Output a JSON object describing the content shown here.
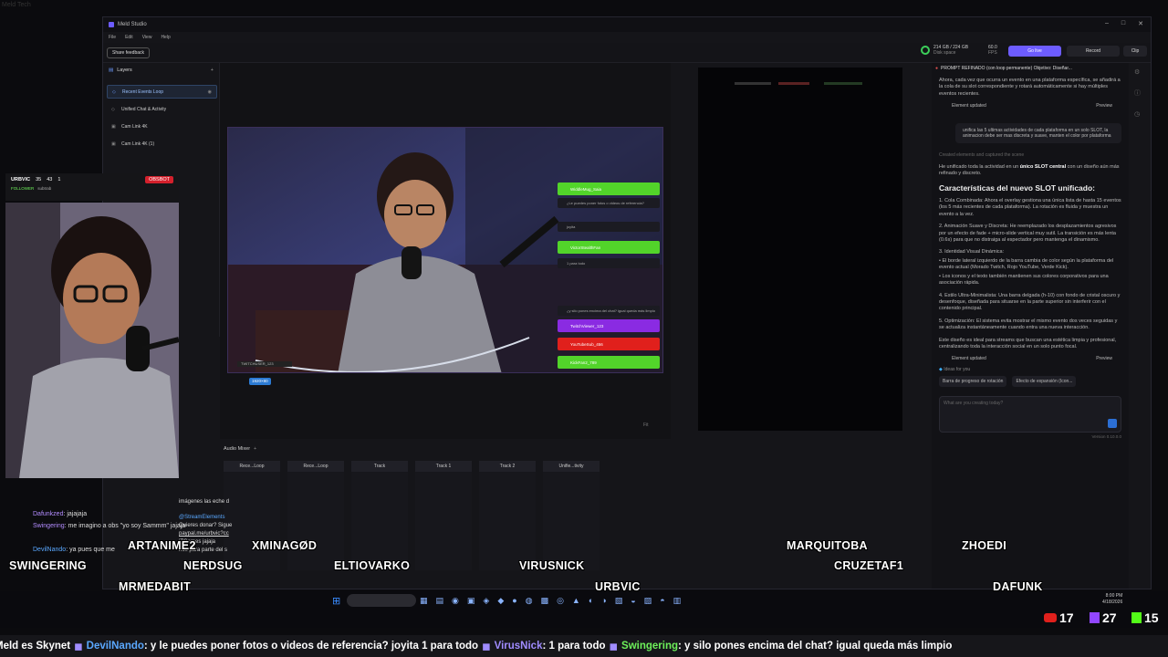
{
  "corner_text": "Meld Tech",
  "app": {
    "title": "Meld Studio",
    "menu": [
      "File",
      "Edit",
      "View",
      "Help"
    ],
    "share_feedback": "Share feedback",
    "disk": {
      "value": "214 GB / 224 GB",
      "label": "Disk space"
    },
    "fps": {
      "value": "60.0",
      "label": "FPS"
    },
    "go_live": "Go live",
    "record": "Record",
    "clip": "Clip"
  },
  "layers": {
    "title": "Layers",
    "items": [
      {
        "label": "Recent Events Loop",
        "selected": true
      },
      {
        "label": "Unified Chat & Activity",
        "selected": false
      },
      {
        "label": "Cam Link 4K",
        "selected": false
      },
      {
        "label": "Cam Link 4K (1)",
        "selected": false
      }
    ]
  },
  "preview": {
    "resolution_badge": "1920×80",
    "zoom": "Fit",
    "alerts": [
      {
        "text": "WiddleMug_Saia",
        "color": "#52d42a"
      },
      {
        "text": "VictorStealthFan",
        "color": "#52d42a"
      },
      {
        "text": "TwitchViewer_123",
        "color": "#8a2be2"
      },
      {
        "text": "YouTubeSub_456",
        "color": "#e0201c"
      },
      {
        "text": "KickFan2_789",
        "color": "#52d42a"
      }
    ],
    "chat_rows": [
      "¿Le puedes poner fotos o videos de referencia?",
      "joyita",
      "1 para todo",
      "¿y silo pones encima del chat? igual queda más limpio"
    ]
  },
  "mixer": {
    "title": "Audio Mixer",
    "tracks": [
      "Rece...Loop",
      "Rece...Loop",
      "Track",
      "Track 1",
      "Track 2",
      "Unifie...tivity"
    ],
    "edit": "EDIT",
    "mute": "MUTE",
    "cue": "CUE"
  },
  "ai": {
    "header": "PROMPT REFINADO (con loop permanente) Objetivo: Diseñar...",
    "intro": "Ahora, cada vez que ocurra un evento en una plataforma específica, se añadirá a la cola de su slot correspondiente y rotará automáticamente si hay múltiples eventos recientes.",
    "element_updated": "Element updated",
    "preview": "Preview",
    "user_msg": "unifica las 5 ultimas actividades de cada plataforma en un solo SLOT, la animacion debe ser mas discreta y suave, manten el color por plataforma",
    "created": "Created elements and captured the scene",
    "summary_a": "He unificado toda la actividad en un ",
    "summary_b": "único SLOT central",
    "summary_c": " con un diseño aún más refinado y discreto.",
    "heading": "Características del nuevo SLOT unificado:",
    "points": [
      "1. Cola Combinada: Ahora el overlay gestiona una única lista de hasta 15 eventos (los 5 más recientes de cada plataforma). La rotación es fluida y muestra un evento a la vez.",
      "2. Animación Suave y Discreta: He reemplazado los desplazamientos agresivos por un efecto de fade + micro-slide vertical muy sutil. La transición es más lenta (0.6s) para que no distraiga al espectador pero mantenga el dinamismo.",
      "3. Identidad Visual Dinámica:",
      "• El borde lateral izquierdo de la barra cambia de color según la plataforma del evento actual (Morado Twitch, Rojo YouTube, Verde Kick).",
      "• Los iconos y el texto también mantienen sus colores corporativos para una asociación rápida.",
      "4. Estilo Ultra-Minimalista: Una barra delgada (h-10) con fondo de cristal oscuro y desenfoque, diseñada para situarse en la parte superior sin interferir con el contenido principal.",
      "5. Optimización: El sistema evita mostrar el mismo evento dos veces seguidas y se actualiza instantáneamente cuando entra una nueva interacción."
    ],
    "closing": "Este diseño es ideal para streams que buscan una estética limpia y profesional, centralizando toda la interacción social en un solo punto focal.",
    "ideas": "Ideas for you",
    "idea1": "Barra de progreso de rotación",
    "idea2": "Efecto de expansión (Icon...",
    "input_placeholder": "What are you creating today?",
    "version": "Version 0.10.0.0"
  },
  "stream_overlay": {
    "hud_name": "URBVIC",
    "hud_stats": [
      "35",
      "43",
      "1"
    ],
    "hud_badge": "OBSBOT",
    "hud_follow": "FOLLOWER",
    "hud_follow_name": "subtrab",
    "chat": [
      {
        "user": "Dafunkzed",
        "text": "jajajaja",
        "color": "#b38cff"
      },
      {
        "user": "Swingering",
        "text": "me imagino a obs \"yo soy Sammm\" jajaja",
        "color": "#b38cff"
      },
      {
        "user": "DevilNando",
        "text": "ya pues que me",
        "color": "#5aa8ff"
      }
    ],
    "elements_chat": [
      "imágenes las eche d",
      "@StreamElements",
      "Quieres donar? Sigue",
      "paypal.me/urbvic?cc",
      "jTGames jajaja",
      "nos para parte del s"
    ],
    "names": [
      "SWINGERING",
      "ARTANIME2",
      "XMINAGØD",
      "NERDSUG",
      "MRMEDABIT",
      "ELTIOVARKO",
      "VIRUSNICK",
      "URBVIC",
      "MARQUITOBA",
      "ZHOEDI",
      "CRUZETAF1",
      "DAFUNK"
    ]
  },
  "taskbar": {
    "time": "8:00 PM",
    "date": "4/18/2026",
    "counts": {
      "youtube": "17",
      "twitch": "27",
      "kick": "15"
    }
  },
  "ticker": [
    {
      "user": "Meld es Skynet",
      "text": "",
      "style": "plain"
    },
    {
      "user": "DevilNando",
      "text": ": y le puedes poner fotos o videos de referencia? joyita 1 para todo",
      "style": "blue"
    },
    {
      "user": "VirusNick",
      "text": ": 1 para todo",
      "style": "purple"
    },
    {
      "user": "Swingering",
      "text": ": y silo pones encima del chat? igual queda más limpio",
      "style": "green"
    }
  ]
}
